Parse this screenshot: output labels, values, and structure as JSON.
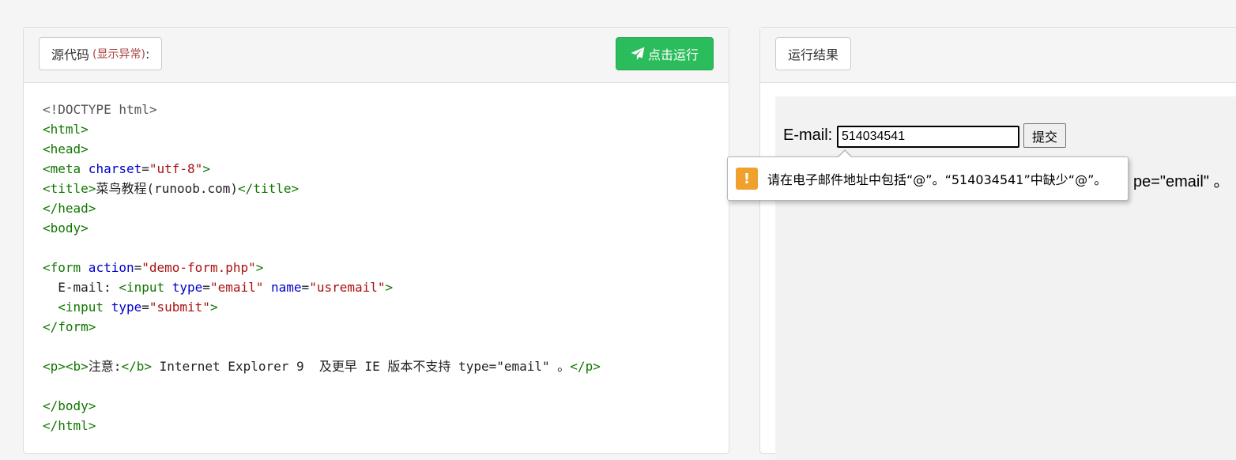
{
  "source_panel": {
    "title": "源代码",
    "hint": "(显示异常)",
    "suffix": ":",
    "run_button": "点击运行",
    "run_icon": "paper-plane-icon",
    "code": {
      "doctype": "<!DOCTYPE html>",
      "html_open": "<html>",
      "head_open": "<head>",
      "meta_open": "<meta",
      "meta_attr": " charset",
      "eq": "=",
      "meta_val": "\"utf-8\"",
      "meta_close": ">",
      "title_open": "<title>",
      "title_text": "菜鸟教程(runoob.com)",
      "title_close": "</title>",
      "head_close": "</head>",
      "body_open": "<body>",
      "form_open": "<form",
      "form_attr": " action",
      "form_val": "\"demo-form.php\"",
      "form_gt": ">",
      "email_label": "  E-mail: ",
      "input_open": "<input",
      "type_attr": " type",
      "email_val": "\"email\"",
      "name_attr": " name",
      "name_val": "\"usremail\"",
      "input_gt": ">",
      "indent": "  ",
      "submit_val": "\"submit\"",
      "form_close": "</form>",
      "p_b_open": "<p><b>",
      "note_label": "注意:",
      "b_close": "</b>",
      "note_text": " Internet Explorer 9  及更早 IE 版本不支持 type=\"email\" 。",
      "p_close": "</p>",
      "body_close": "</body>",
      "html_close": "</html>"
    }
  },
  "result_panel": {
    "title": "运行结果",
    "email_label": "E-mail:",
    "email_value": "514034541",
    "submit_label": "提交",
    "partial_text": "pe=\"email\" 。",
    "tooltip_icon": "warning-icon",
    "tooltip_icon_glyph": "!",
    "tooltip_text": "请在电子邮件地址中包括“@”。“514034541”中缺少“@”。"
  },
  "colors": {
    "run_button": "#2bbc5b",
    "code_tag": "#117700",
    "code_attr": "#0000cc",
    "code_value": "#aa1111",
    "warning": "#f0a02c"
  }
}
